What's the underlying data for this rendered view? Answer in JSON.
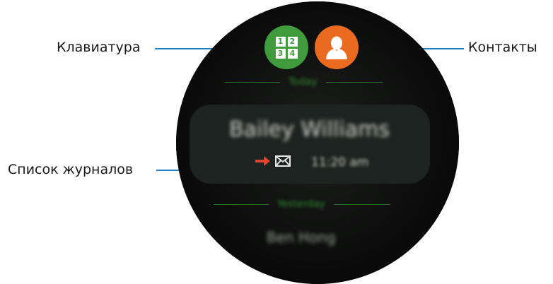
{
  "callouts": {
    "keypad": "Клавиатура",
    "contacts": "Контакты",
    "logs_list": "Список журналов"
  },
  "watch": {
    "keypad_button": {
      "icon": "keypad-icon",
      "color": "#3f9b3b",
      "digits": [
        "1",
        "2",
        "3",
        "4"
      ]
    },
    "contacts_button": {
      "icon": "contact-person-icon",
      "color": "#ea6a1f"
    },
    "sections": [
      {
        "label": "Today",
        "entries": [
          {
            "name": "Bailey Williams",
            "direction_icon": "outgoing-arrow-icon",
            "type_icon": "message-icon",
            "time": "11:20 am"
          }
        ]
      },
      {
        "label": "Yesterday",
        "entries": [
          {
            "name": "Ben Hong"
          }
        ]
      }
    ]
  },
  "colors": {
    "leader_line": "#1f7fc4",
    "section_label": "#2f8a2f",
    "outgoing_arrow": "#e0432a"
  }
}
